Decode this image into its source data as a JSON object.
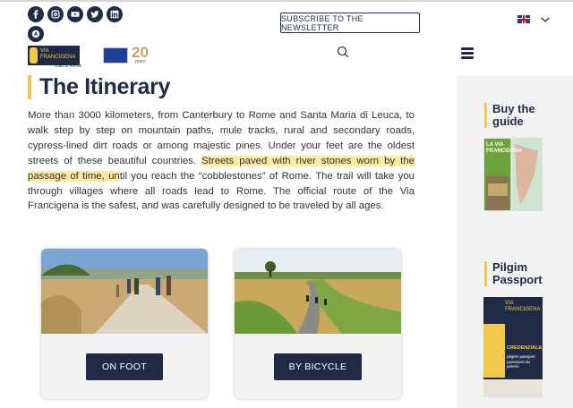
{
  "header": {
    "social_icons": [
      "facebook-icon",
      "instagram-icon",
      "youtube-icon",
      "twitter-icon",
      "linkedin-icon",
      "komoot-icon"
    ],
    "newsletter_label": "SUBSCRIBE TO THE NEWSLETTER",
    "language_flag": "uk-flag-icon",
    "logo": {
      "line1": "VIA",
      "line2": "FRANCIGENA",
      "tagline": "road to Rome",
      "anniversary": "20",
      "anniversary_sub": "years"
    }
  },
  "main": {
    "title": "The Itinerary",
    "intro_before": "More than 3000 kilometers, from Canterbury to Rome and Santa Maria di Leuca, to walk step by step on mountain paths, mule tracks, rural and secondary roads, cypress-lined dirt roads or among majestic pines. Under your feet are the oldest streets of these beautiful countries. ",
    "intro_highlight": "Streets paved with river stones worn by the passage of time, un",
    "intro_after": "til you reach the “cobblestones” of Rome. The trail will take you through villages where all roads lead to Rome. The official route of the Via Francigena is the safest, and was carefully designed to be traveled by all ages.",
    "cards": [
      {
        "label": "ON FOOT"
      },
      {
        "label": "BY BICYCLE"
      }
    ]
  },
  "sidebar": {
    "guide_heading": "Buy the guide",
    "guide_cover_title": "LA VIA FRANCIGENA",
    "passport_heading": "Pilgim Passport",
    "passport_cover_title": "VIA FRANCIGENA",
    "passport_cover_sub": "CREDENZIALE",
    "passport_cover_line2": "pilgrim passport",
    "passport_cover_line3": "passeport du pèlerin"
  },
  "colors": {
    "navy": "#1f2b45",
    "accent_yellow": "#f2c94c",
    "highlight": "#fbeaa0"
  }
}
